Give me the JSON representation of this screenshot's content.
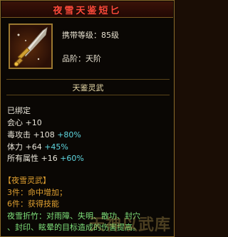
{
  "item": {
    "name": "夜雪天鉴短匕",
    "level_label": "携带等级：85级",
    "grade_label": "品阶：天阶",
    "category": "天鉴灵武"
  },
  "status": "已绑定",
  "stats": [
    {
      "label": "会心",
      "base": "+10",
      "bonus": ""
    },
    {
      "label": "毒攻击",
      "base": "+108",
      "bonus": "+80%"
    },
    {
      "label": "体力",
      "base": "+64",
      "bonus": "+45%"
    },
    {
      "label": "所有属性",
      "base": "+16",
      "bonus": "+60%"
    }
  ],
  "set": {
    "title": "【夜雪灵武】",
    "piece3": "3件：命中增加；",
    "piece6": "6件：获得技能",
    "skill_line1": "夜雪折竹：对雨障、失明、散功、封穴",
    "skill_line2": "、封印、眩晕的目标造成的伤害提高。"
  },
  "watermark": "天神以武库",
  "colors": {
    "title": "#ff4a3a",
    "gold": "#e0a030",
    "green": "#7ee07a",
    "cyan": "#5fd7e0"
  }
}
